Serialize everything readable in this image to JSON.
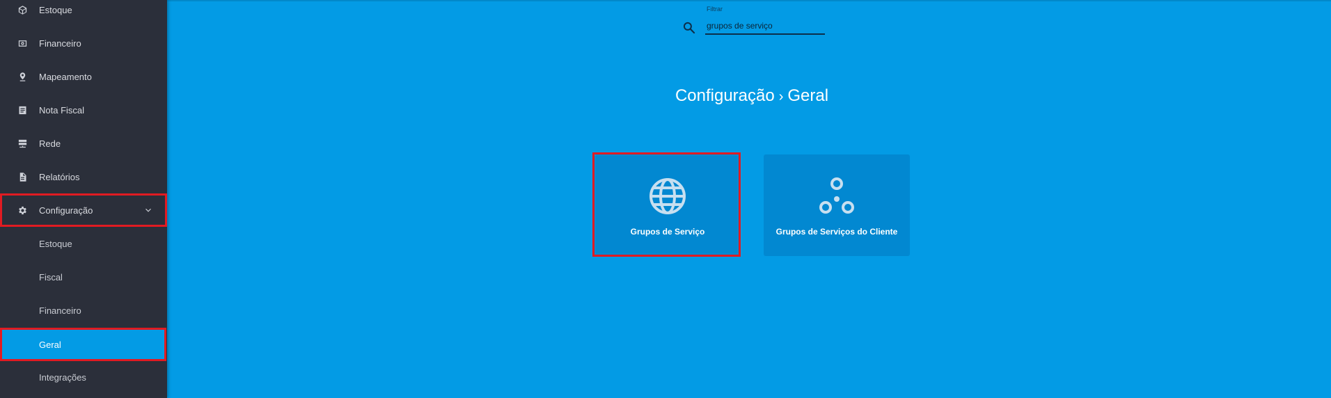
{
  "sidebar": {
    "items": [
      {
        "label": "Estoque",
        "icon": "box-icon"
      },
      {
        "label": "Financeiro",
        "icon": "money-icon"
      },
      {
        "label": "Mapeamento",
        "icon": "map-pin-icon"
      },
      {
        "label": "Nota Fiscal",
        "icon": "document-icon"
      },
      {
        "label": "Rede",
        "icon": "server-icon"
      },
      {
        "label": "Relatórios",
        "icon": "report-icon"
      },
      {
        "label": "Configuração",
        "icon": "gear-icon",
        "expanded": true
      }
    ],
    "subitems": [
      {
        "label": "Estoque"
      },
      {
        "label": "Fiscal"
      },
      {
        "label": "Financeiro"
      },
      {
        "label": "Geral",
        "active": true
      },
      {
        "label": "Integrações"
      }
    ]
  },
  "search": {
    "label": "Filtrar",
    "value": "grupos de serviço"
  },
  "breadcrumb": {
    "parent": "Configuração",
    "separator": "›",
    "current": "Geral"
  },
  "cards": [
    {
      "label": "Grupos de Serviço",
      "icon": "globe-icon"
    },
    {
      "label": "Grupos de Serviços do Cliente",
      "icon": "group-circles-icon"
    }
  ],
  "colors": {
    "sidebar_bg": "#2b2f3a",
    "main_bg": "#039be5",
    "card_bg": "#0288d1",
    "highlight": "#e11b22"
  }
}
